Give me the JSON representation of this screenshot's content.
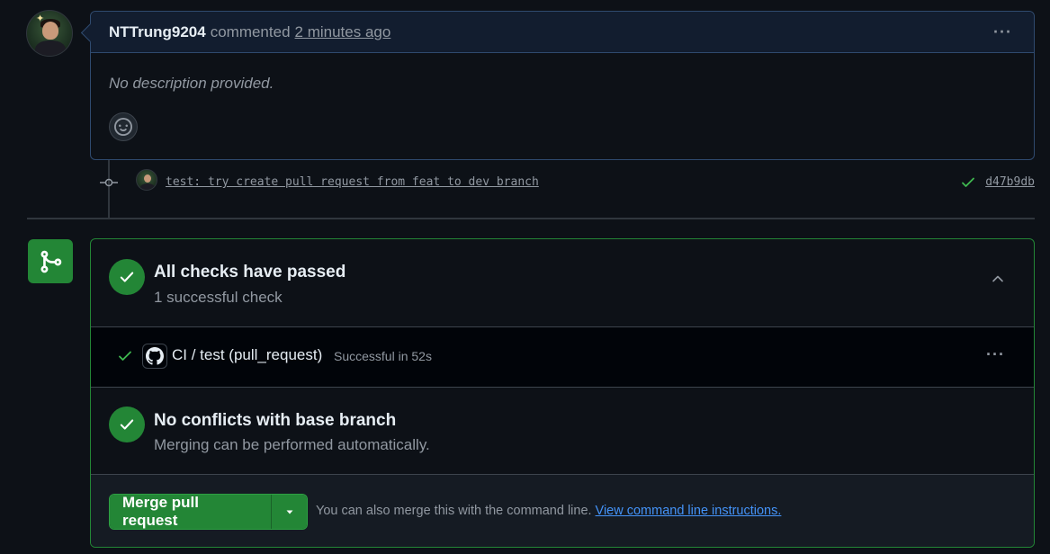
{
  "comment": {
    "author": "NTTrung9204",
    "verb": "commented",
    "time": "2 minutes ago",
    "body": "No description provided."
  },
  "commit": {
    "message": "test: try create pull request from feat to dev branch",
    "sha": "d47b9db",
    "status": "success"
  },
  "checks": {
    "title": "All checks have passed",
    "subtitle": "1 successful check",
    "items": [
      {
        "name": "CI / test (pull_request)",
        "status": "Successful in 52s"
      }
    ]
  },
  "conflicts": {
    "title": "No conflicts with base branch",
    "subtitle": "Merging can be performed automatically."
  },
  "merge": {
    "button_label": "Merge pull request",
    "hint": "You can also merge this with the command line.",
    "link": "View command line instructions."
  },
  "colors": {
    "accent_green": "#238636",
    "link_blue": "#4493f8",
    "background": "#0d1117"
  }
}
